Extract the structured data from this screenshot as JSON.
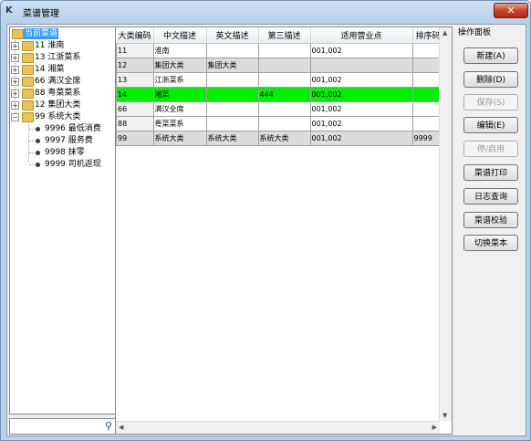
{
  "window": {
    "title": "菜谱管理",
    "close_label": "✕"
  },
  "tree": {
    "root": "当前菜谱",
    "categories": [
      {
        "label": "11 淮南"
      },
      {
        "label": "13 江浙菜系"
      },
      {
        "label": "14 湘菜"
      },
      {
        "label": "66 满汉全席"
      },
      {
        "label": "88 粤菜菜系"
      },
      {
        "label": "12 集团大类"
      },
      {
        "label": "99 系统大类"
      }
    ],
    "children": [
      {
        "label": "9996 最低消费"
      },
      {
        "label": "9997 服务费"
      },
      {
        "label": "9998 抹零"
      },
      {
        "label": "9999 司机返现"
      }
    ]
  },
  "grid": {
    "columns": [
      "大类编码",
      "中文描述",
      "英文描述",
      "第三描述",
      "适用营业点",
      "排序码"
    ],
    "rows": [
      {
        "code": "11",
        "cn": "淮南",
        "en": "",
        "third": "",
        "sites": "001,002",
        "sort": ""
      },
      {
        "code": "12",
        "cn": "集团大类",
        "en": "集团大类",
        "third": "",
        "sites": "",
        "sort": ""
      },
      {
        "code": "13",
        "cn": "江浙菜系",
        "en": "",
        "third": "",
        "sites": "001,002",
        "sort": ""
      },
      {
        "code": "14",
        "cn": "湘菜",
        "en": "",
        "third": "444",
        "sites": "001,002",
        "sort": ""
      },
      {
        "code": "66",
        "cn": "满汉全席",
        "en": "",
        "third": "",
        "sites": "001,002",
        "sort": ""
      },
      {
        "code": "88",
        "cn": "粤菜菜系",
        "en": "",
        "third": "",
        "sites": "001,002",
        "sort": ""
      },
      {
        "code": "99",
        "cn": "系统大类",
        "en": "系统大类",
        "third": "系统大类",
        "sites": "001,002",
        "sort": "9999"
      }
    ]
  },
  "ops": {
    "title": "操作面板",
    "new": "新建(A)",
    "delete": "删除(D)",
    "save": "保存(S)",
    "edit": "编辑(E)",
    "toggle": "停/启用",
    "print": "菜谱打印",
    "log": "日志查询",
    "check": "菜谱校验",
    "switch": "切换菜本"
  },
  "colors": {
    "selected_row": "#00ee00",
    "tree_selection": "#3399ff"
  }
}
